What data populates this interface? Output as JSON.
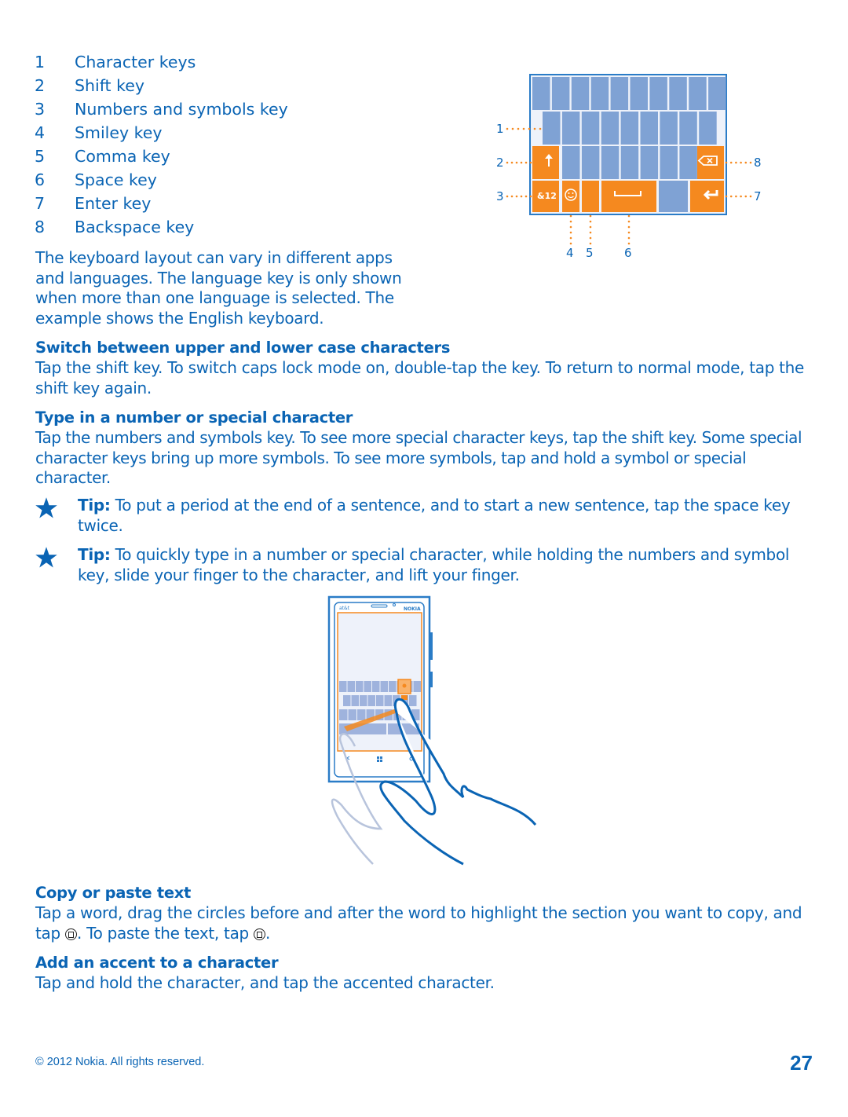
{
  "legend": [
    {
      "num": "1",
      "label": "Character keys"
    },
    {
      "num": "2",
      "label": "Shift key"
    },
    {
      "num": "3",
      "label": "Numbers and symbols key"
    },
    {
      "num": "4",
      "label": "Smiley key"
    },
    {
      "num": "5",
      "label": "Comma key"
    },
    {
      "num": "6",
      "label": "Space key"
    },
    {
      "num": "7",
      "label": "Enter key"
    },
    {
      "num": "8",
      "label": "Backspace key"
    }
  ],
  "intro": "The keyboard layout can vary in different apps and languages. The language key is only shown when more than one language is selected. The example shows the English keyboard.",
  "keyboard_diagram": {
    "callouts": [
      "1",
      "2",
      "3",
      "4",
      "5",
      "6",
      "7",
      "8"
    ],
    "numbers_key_label": "&12",
    "colors": {
      "character_key": "#7fa2d4",
      "function_key": "#f5891f",
      "frame": "#2a7cc7",
      "background": "#eef2fa"
    }
  },
  "sections": [
    {
      "heading": "Switch between upper and lower case characters",
      "body": "Tap the shift key. To switch caps lock mode on, double-tap the key. To return to normal mode, tap the shift key again."
    },
    {
      "heading": "Type in a number or special character",
      "body": "Tap the numbers and symbols key. To see more special character keys, tap the shift key. Some special character keys bring up more symbols. To see more symbols, tap and hold a symbol or special character."
    }
  ],
  "tips": [
    {
      "label": "Tip:",
      "text": " To put a period at the end of a sentence, and to start a new sentence, tap the space key twice."
    },
    {
      "label": "Tip:",
      "text": " To quickly type in a number or special character, while holding the numbers and symbol key, slide your finger to the character, and lift your finger."
    }
  ],
  "phone_illustration": {
    "carrier": "at&t",
    "brand": "NOKIA"
  },
  "copy_paste": {
    "heading": "Copy or paste text",
    "body_1": "Tap a word, drag the circles before and after the word to highlight the section you want to copy, and tap ",
    "body_2": ". To paste the text, tap ",
    "body_3": "."
  },
  "accent": {
    "heading": "Add an accent to a character",
    "body": "Tap and hold the character, and tap the accented character."
  },
  "footer": {
    "copyright": "© 2012 Nokia. All rights reserved.",
    "page": "27"
  }
}
